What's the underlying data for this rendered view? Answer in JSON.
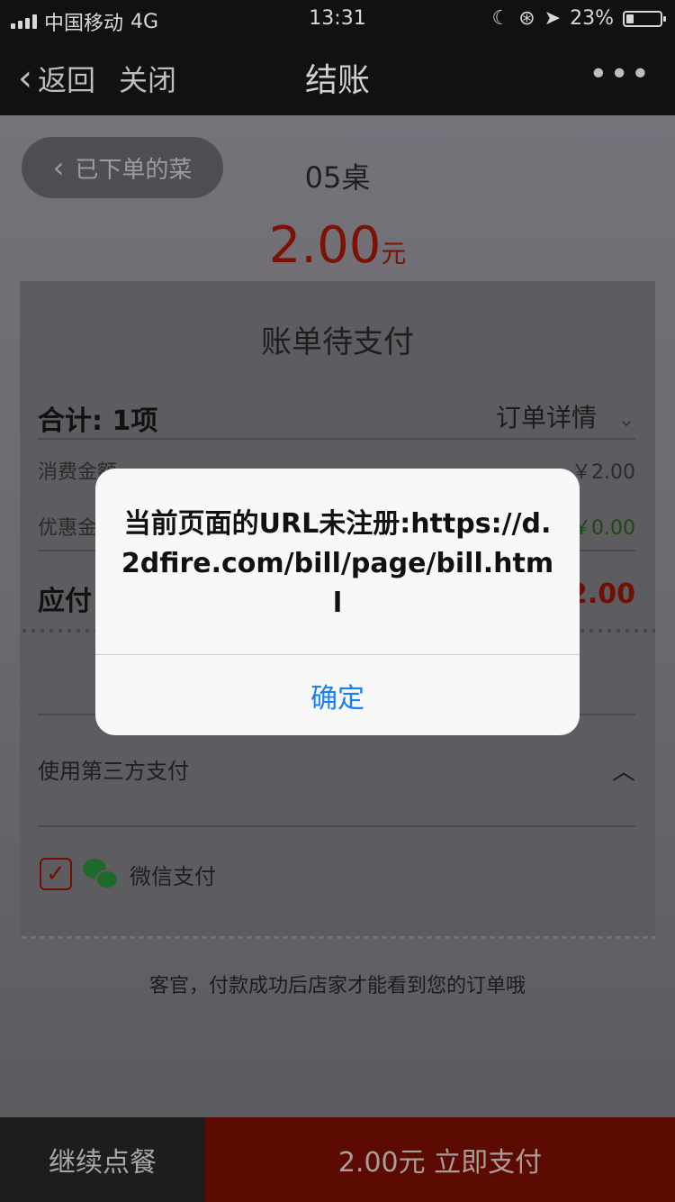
{
  "status_bar": {
    "carrier": "中国移动",
    "network": "4G",
    "time": "13:31",
    "battery": "23%",
    "battery_level": 0.23
  },
  "nav": {
    "back_label": "返回",
    "close_label": "关闭",
    "title": "结账",
    "more_label": "•••"
  },
  "order": {
    "ordered_label": "已下单的菜",
    "table": "05桌",
    "amount": "2.00",
    "amount_unit": "元"
  },
  "bill": {
    "title": "账单待支付",
    "total_label": "合计: 1项",
    "details_label": "订单详情",
    "consume_label": "消费金额",
    "consume_value": "￥2.00",
    "discount_label": "优惠金",
    "discount_value": "￥0.00",
    "payable_label": "应付",
    "payable_value": "2.00",
    "third_party_label": "使用第三方支付",
    "wechat_label": "微信支付",
    "tip": "客官，付款成功后店家才能看到您的订单哦"
  },
  "bottom": {
    "continue_label": "继续点餐",
    "pay_label": "2.00元 立即支付"
  },
  "dialog": {
    "message": "当前页面的URL未注册:https://d.2dfire.com/bill/page/bill.html",
    "ok_label": "确定"
  },
  "colors": {
    "accent_red": "#c0210d",
    "ios_blue": "#157efb",
    "wechat_green": "#3cb034"
  }
}
